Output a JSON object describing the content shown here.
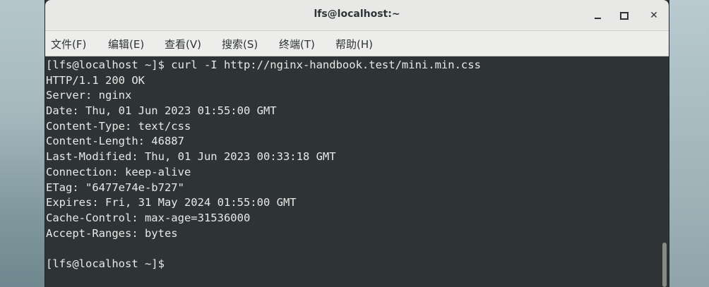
{
  "window": {
    "title": "lfs@localhost:~"
  },
  "menu": {
    "items": [
      "文件(F)",
      "编辑(E)",
      "查看(V)",
      "搜索(S)",
      "终端(T)",
      "帮助(H)"
    ]
  },
  "terminal": {
    "lines": [
      "[lfs@localhost ~]$ curl -I http://nginx-handbook.test/mini.min.css",
      "HTTP/1.1 200 OK",
      "Server: nginx",
      "Date: Thu, 01 Jun 2023 01:55:00 GMT",
      "Content-Type: text/css",
      "Content-Length: 46887",
      "Last-Modified: Thu, 01 Jun 2023 00:33:18 GMT",
      "Connection: keep-alive",
      "ETag: \"6477e74e-b727\"",
      "Expires: Fri, 31 May 2024 01:55:00 GMT",
      "Cache-Control: max-age=31536000",
      "Accept-Ranges: bytes",
      "",
      "[lfs@localhost ~]$"
    ]
  },
  "icons": {
    "minimize": "minimize-icon",
    "maximize": "maximize-icon",
    "close": "close-icon"
  },
  "colors": {
    "terminal_bg": "#2e3436",
    "terminal_fg": "#e8e9e7",
    "titlebar_bg": "#e8e8e7"
  }
}
